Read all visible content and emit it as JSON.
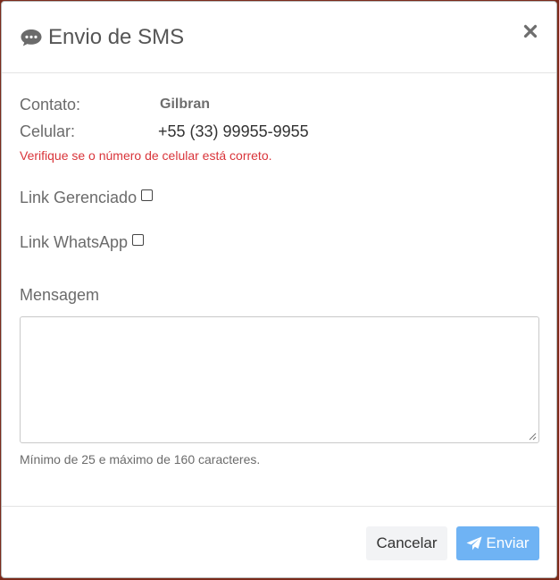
{
  "header": {
    "title": "Envio de SMS",
    "icon": "chat-bubble-icon",
    "close_icon": "close-icon"
  },
  "contact": {
    "contact_label": "Contato:",
    "contact_value": "Gilbran",
    "phone_label": "Celular:",
    "phone_value": "+55 (33) 99955-9955",
    "warning": "Verifique se o número de celular está correto."
  },
  "options": {
    "managed_link_label": "Link Gerenciado",
    "managed_link_checked": false,
    "whatsapp_link_label": "Link WhatsApp",
    "whatsapp_link_checked": false
  },
  "message": {
    "label": "Mensagem",
    "value": "",
    "hint": "Mínimo de 25 e máximo de 160 caracteres."
  },
  "footer": {
    "cancel_label": "Cancelar",
    "send_label": "Enviar",
    "send_icon": "paper-plane-icon"
  },
  "colors": {
    "accent": "#6fb3f4",
    "warning": "#d9343a",
    "title": "#555555"
  }
}
